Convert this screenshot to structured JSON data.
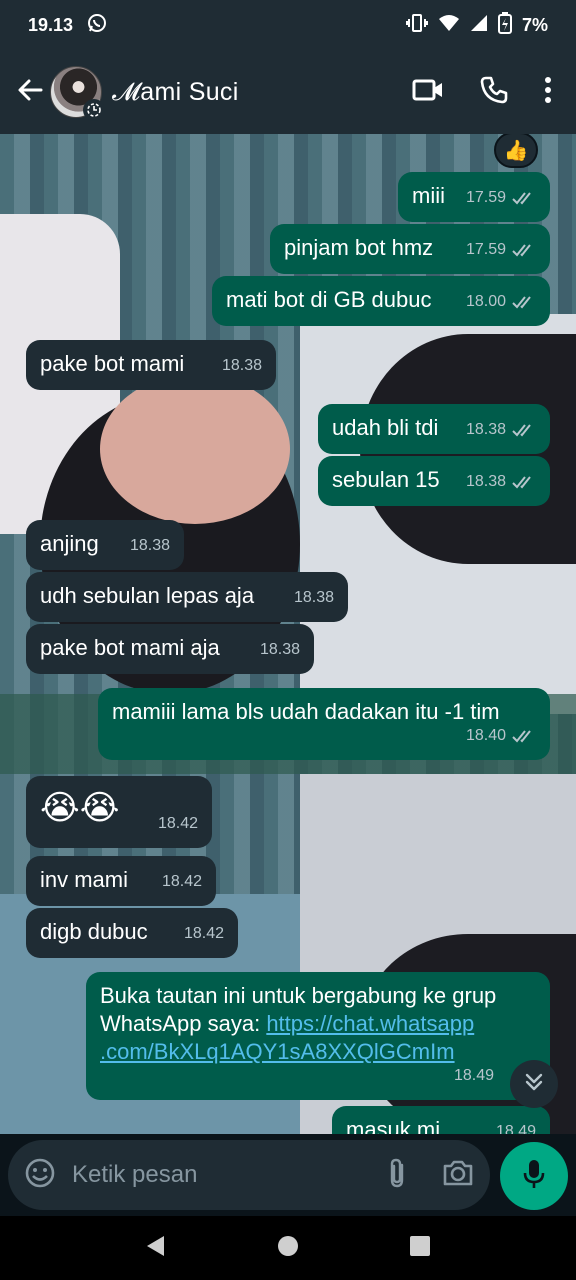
{
  "status": {
    "time": "19.13",
    "battery": "7%"
  },
  "header": {
    "contact_name": "𝓜ami Suci"
  },
  "reaction": {
    "emoji": "👍"
  },
  "messages": [
    {
      "dir": "out",
      "text": "miii",
      "time": "17.59"
    },
    {
      "dir": "out",
      "text": "pinjam bot hmz",
      "time": "17.59"
    },
    {
      "dir": "out",
      "text": "mati bot di GB dubuc",
      "time": "18.00"
    },
    {
      "dir": "in",
      "text": "pake bot mami",
      "time": "18.38"
    },
    {
      "dir": "out",
      "text": "udah bli tdi",
      "time": "18.38"
    },
    {
      "dir": "out",
      "text": "sebulan 15",
      "time": "18.38"
    },
    {
      "dir": "in",
      "text": "anjing",
      "time": "18.38"
    },
    {
      "dir": "in",
      "text": "udh sebulan lepas aja",
      "time": "18.38"
    },
    {
      "dir": "in",
      "text": "pake bot mami aja",
      "time": "18.38"
    },
    {
      "dir": "out",
      "text": "mamiii lama bls udah dadakan itu -1 tim",
      "time": "18.40"
    },
    {
      "dir": "in",
      "text": "😭😭",
      "time": "18.42"
    },
    {
      "dir": "in",
      "text": "inv mami",
      "time": "18.42"
    },
    {
      "dir": "in",
      "text": "digb dubuc",
      "time": "18.42"
    },
    {
      "dir": "out",
      "text_line1": "Buka tautan ini untuk bergabung ke grup",
      "text_line2_prefix": "WhatsApp saya: ",
      "link_part1": "https://chat.whatsapp",
      "link_part2": ".com/BkXLq1AQY1sA8XXQlGCmIm",
      "time": "18.49"
    },
    {
      "dir": "out",
      "text": "masuk mi",
      "time": "18.49"
    }
  ],
  "input": {
    "placeholder": "Ketik pesan"
  },
  "icons": [
    "back-icon",
    "video-call-icon",
    "phone-icon",
    "more-options-icon",
    "emoji-icon",
    "attach-icon",
    "camera-icon",
    "mic-icon",
    "scroll-down-icon",
    "nav-back-icon",
    "nav-home-icon",
    "nav-recents-icon"
  ]
}
